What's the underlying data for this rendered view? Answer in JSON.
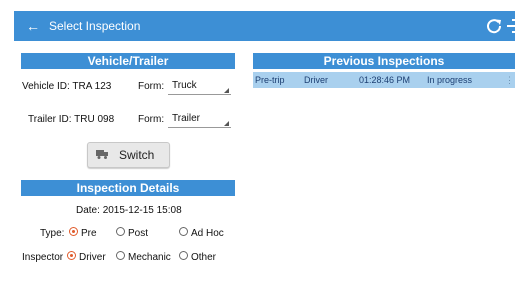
{
  "topbar": {
    "back_icon": "arrow-left-icon",
    "title": "Select Inspection",
    "refresh_icon": "refresh-icon",
    "exit_icon": "exit-icon",
    "color": "#3d8fd5"
  },
  "vehicle_trailer": {
    "header": "Vehicle/Trailer",
    "vehicle_id_label": "Vehicle ID:",
    "vehicle_id": "TRA 123",
    "vehicle_form_label": "Form:",
    "vehicle_form": "Truck",
    "trailer_id_label": "Trailer ID:",
    "trailer_id": "TRU 098",
    "trailer_form_label": "Form:",
    "trailer_form": "Trailer",
    "switch_label": "Switch",
    "switch_icon": "truck-icon"
  },
  "inspection_details": {
    "header": "Inspection Details",
    "date_label": "Date:",
    "date": "2015-12-15 15:08",
    "type_label": "Type:",
    "type_options": [
      "Pre",
      "Post",
      "Ad Hoc"
    ],
    "type_selected": "Pre",
    "inspector_label": "Inspector",
    "inspector_options": [
      "Driver",
      "Mechanic",
      "Other"
    ],
    "inspector_selected": "Driver"
  },
  "previous_inspections": {
    "header": "Previous Inspections",
    "rows": [
      {
        "type": "Pre-trip",
        "inspector": "Driver",
        "time": "01:28:46 PM",
        "status": "In progress"
      }
    ],
    "row_color": "#a9d0ee"
  }
}
